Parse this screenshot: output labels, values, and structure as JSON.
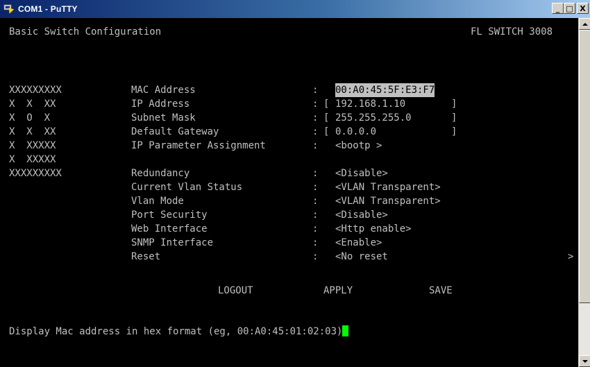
{
  "window": {
    "title": "COM1 - PuTTY",
    "controls": {
      "minimize": "_",
      "maximize": "□",
      "close": "X"
    }
  },
  "terminal": {
    "header_left": "Basic Switch Configuration",
    "header_right": "FL SWITCH 3008",
    "logo": [
      "XXXXXXXXX",
      "X  X  XX",
      "X  O  X",
      "X  X  XX",
      "X  XXXXX",
      "X  XXXXX",
      "XXXXXXXXX"
    ],
    "fields": [
      {
        "label": "MAC Address",
        "sep": ":",
        "open": "",
        "value": "00:A0:45:5F:E3:F7",
        "close": ""
      },
      {
        "label": "IP Address",
        "sep": ":",
        "open": "[",
        "value": "192.168.1.10",
        "close": "]"
      },
      {
        "label": "Subnet Mask",
        "sep": ":",
        "open": "[",
        "value": "255.255.255.0",
        "close": "]"
      },
      {
        "label": "Default Gateway",
        "sep": ":",
        "open": "[",
        "value": "0.0.0.0",
        "close": "]"
      },
      {
        "label": "IP Parameter Assignment",
        "sep": ":",
        "open": "",
        "value": "<bootp >",
        "close": ""
      },
      {
        "label": "Redundancy",
        "sep": ":",
        "open": "",
        "value": "<Disable>",
        "close": ""
      },
      {
        "label": "Current Vlan Status",
        "sep": ":",
        "open": "",
        "value": "<VLAN Transparent>",
        "close": ""
      },
      {
        "label": "Vlan Mode",
        "sep": ":",
        "open": "",
        "value": "<VLAN Transparent>",
        "close": ""
      },
      {
        "label": "Port Security",
        "sep": ":",
        "open": "",
        "value": "<Disable>",
        "close": ""
      },
      {
        "label": "Web Interface",
        "sep": ":",
        "open": "",
        "value": "<Http enable>",
        "close": ""
      },
      {
        "label": "SNMP Interface",
        "sep": ":",
        "open": "",
        "value": "<Enable>",
        "close": ""
      },
      {
        "label": "Reset",
        "sep": ":",
        "open": "",
        "value": "<No reset",
        "close": ""
      }
    ],
    "right_marker": ">",
    "actions": {
      "logout": "LOGOUT",
      "apply": "APPLY",
      "save": "SAVE"
    },
    "status": "Display Mac address in hex format (eg, 00:A0:45:01:02:03)"
  }
}
